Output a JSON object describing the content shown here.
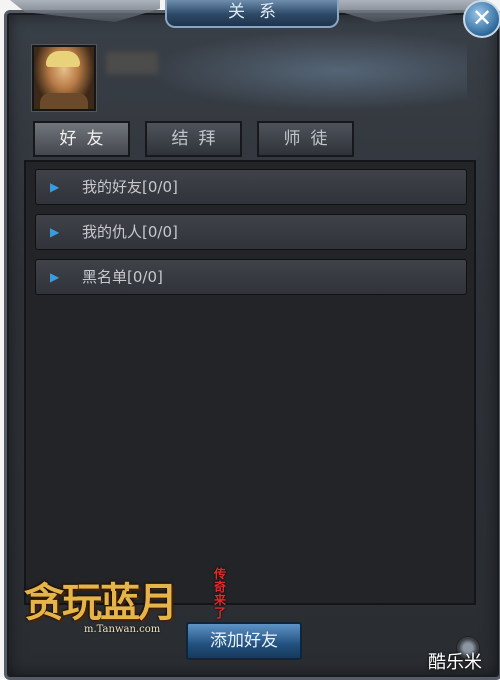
{
  "window": {
    "title": "关系"
  },
  "tabs": [
    {
      "label": "好友"
    },
    {
      "label": "结拜"
    },
    {
      "label": "师徒"
    }
  ],
  "list": {
    "items": [
      {
        "label": "我的好友[0/0]"
      },
      {
        "label": "我的仇人[0/0]"
      },
      {
        "label": "黑名单[0/0]"
      }
    ]
  },
  "buttons": {
    "add_friend": "添加好友",
    "close": "✕"
  },
  "logo": {
    "title": "贪玩蓝月",
    "slogan": "传奇来了",
    "url": "m.Tanwan.com"
  },
  "watermark": "酷乐米",
  "colors": {
    "accent": "#3a9ce0",
    "panel": "#2e3238"
  }
}
